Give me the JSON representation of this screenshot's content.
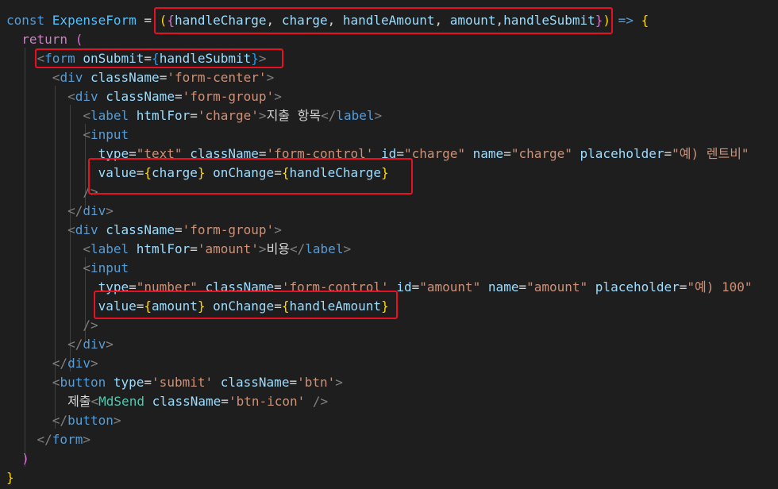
{
  "editor": {
    "lines": [
      [
        [
          "const ",
          "kw"
        ],
        [
          "ExpenseForm",
          "const"
        ],
        [
          " = ",
          "op"
        ],
        [
          "(",
          "brace1"
        ],
        [
          "{",
          "brace2"
        ],
        [
          "handleCharge",
          "var"
        ],
        [
          ", ",
          "plain"
        ],
        [
          "charge",
          "var"
        ],
        [
          ", ",
          "plain"
        ],
        [
          "handleAmount",
          "var"
        ],
        [
          ", ",
          "plain"
        ],
        [
          "amount",
          "var"
        ],
        [
          ",",
          "plain"
        ],
        [
          "handleSubmit",
          "var"
        ],
        [
          "}",
          "brace2"
        ],
        [
          ")",
          "brace1"
        ],
        [
          " => ",
          "kw"
        ],
        [
          "{",
          "brace1"
        ]
      ],
      [
        [
          "  ",
          "plain"
        ],
        [
          "return",
          "ctrl"
        ],
        [
          " ",
          "plain"
        ],
        [
          "(",
          "brace2"
        ]
      ],
      [
        [
          "    ",
          "plain"
        ],
        [
          "<",
          "punct"
        ],
        [
          "form",
          "tag"
        ],
        [
          " ",
          "plain"
        ],
        [
          "onSubmit",
          "attr"
        ],
        [
          "=",
          "op"
        ],
        [
          "{",
          "brace3"
        ],
        [
          "handleSubmit",
          "var"
        ],
        [
          "}",
          "brace3"
        ],
        [
          ">",
          "punct"
        ]
      ],
      [
        [
          "      ",
          "plain"
        ],
        [
          "<",
          "punct"
        ],
        [
          "div",
          "tag"
        ],
        [
          " ",
          "plain"
        ],
        [
          "className",
          "attr"
        ],
        [
          "=",
          "op"
        ],
        [
          "'form-center'",
          "str"
        ],
        [
          ">",
          "punct"
        ]
      ],
      [
        [
          "        ",
          "plain"
        ],
        [
          "<",
          "punct"
        ],
        [
          "div",
          "tag"
        ],
        [
          " ",
          "plain"
        ],
        [
          "className",
          "attr"
        ],
        [
          "=",
          "op"
        ],
        [
          "'form-group'",
          "str"
        ],
        [
          ">",
          "punct"
        ]
      ],
      [
        [
          "          ",
          "plain"
        ],
        [
          "<",
          "punct"
        ],
        [
          "label",
          "tag"
        ],
        [
          " ",
          "plain"
        ],
        [
          "htmlFor",
          "attr"
        ],
        [
          "=",
          "op"
        ],
        [
          "'charge'",
          "str"
        ],
        [
          ">",
          "punct"
        ],
        [
          "지출 항목",
          "plain"
        ],
        [
          "</",
          "punct"
        ],
        [
          "label",
          "tag"
        ],
        [
          ">",
          "punct"
        ]
      ],
      [
        [
          "          ",
          "plain"
        ],
        [
          "<",
          "punct"
        ],
        [
          "input",
          "tag"
        ]
      ],
      [
        [
          "            ",
          "plain"
        ],
        [
          "type",
          "attr"
        ],
        [
          "=",
          "op"
        ],
        [
          "\"text\"",
          "str"
        ],
        [
          " ",
          "plain"
        ],
        [
          "className",
          "attr"
        ],
        [
          "=",
          "op"
        ],
        [
          "'form-control'",
          "str"
        ],
        [
          " ",
          "plain"
        ],
        [
          "id",
          "attr"
        ],
        [
          "=",
          "op"
        ],
        [
          "\"charge\"",
          "str"
        ],
        [
          " ",
          "plain"
        ],
        [
          "name",
          "attr"
        ],
        [
          "=",
          "op"
        ],
        [
          "\"charge\"",
          "str"
        ],
        [
          " ",
          "plain"
        ],
        [
          "placeholder",
          "attr"
        ],
        [
          "=",
          "op"
        ],
        [
          "\"예) 렌트비\"",
          "str"
        ]
      ],
      [
        [
          "            ",
          "plain"
        ],
        [
          "value",
          "attr"
        ],
        [
          "=",
          "op"
        ],
        [
          "{",
          "brace1"
        ],
        [
          "charge",
          "var"
        ],
        [
          "}",
          "brace1"
        ],
        [
          " ",
          "plain"
        ],
        [
          "onChange",
          "attr"
        ],
        [
          "=",
          "op"
        ],
        [
          "{",
          "brace1"
        ],
        [
          "handleCharge",
          "var"
        ],
        [
          "}",
          "brace1"
        ]
      ],
      [
        [
          "          ",
          "plain"
        ],
        [
          "/>",
          "punct"
        ]
      ],
      [
        [
          "        ",
          "plain"
        ],
        [
          "</",
          "punct"
        ],
        [
          "div",
          "tag"
        ],
        [
          ">",
          "punct"
        ]
      ],
      [
        [
          "        ",
          "plain"
        ],
        [
          "<",
          "punct"
        ],
        [
          "div",
          "tag"
        ],
        [
          " ",
          "plain"
        ],
        [
          "className",
          "attr"
        ],
        [
          "=",
          "op"
        ],
        [
          "'form-group'",
          "str"
        ],
        [
          ">",
          "punct"
        ]
      ],
      [
        [
          "          ",
          "plain"
        ],
        [
          "<",
          "punct"
        ],
        [
          "label",
          "tag"
        ],
        [
          " ",
          "plain"
        ],
        [
          "htmlFor",
          "attr"
        ],
        [
          "=",
          "op"
        ],
        [
          "'amount'",
          "str"
        ],
        [
          ">",
          "punct"
        ],
        [
          "비용",
          "plain"
        ],
        [
          "</",
          "punct"
        ],
        [
          "label",
          "tag"
        ],
        [
          ">",
          "punct"
        ]
      ],
      [
        [
          "          ",
          "plain"
        ],
        [
          "<",
          "punct"
        ],
        [
          "input",
          "tag"
        ]
      ],
      [
        [
          "            ",
          "plain"
        ],
        [
          "type",
          "attr"
        ],
        [
          "=",
          "op"
        ],
        [
          "\"number\"",
          "str"
        ],
        [
          " ",
          "plain"
        ],
        [
          "className",
          "attr"
        ],
        [
          "=",
          "op"
        ],
        [
          "'form-control'",
          "str"
        ],
        [
          " ",
          "plain"
        ],
        [
          "id",
          "attr"
        ],
        [
          "=",
          "op"
        ],
        [
          "\"amount\"",
          "str"
        ],
        [
          " ",
          "plain"
        ],
        [
          "name",
          "attr"
        ],
        [
          "=",
          "op"
        ],
        [
          "\"amount\"",
          "str"
        ],
        [
          " ",
          "plain"
        ],
        [
          "placeholder",
          "attr"
        ],
        [
          "=",
          "op"
        ],
        [
          "\"예) 100\"",
          "str"
        ]
      ],
      [
        [
          "            ",
          "plain"
        ],
        [
          "value",
          "attr"
        ],
        [
          "=",
          "op"
        ],
        [
          "{",
          "brace1"
        ],
        [
          "amount",
          "var"
        ],
        [
          "}",
          "brace1"
        ],
        [
          " ",
          "plain"
        ],
        [
          "onChange",
          "attr"
        ],
        [
          "=",
          "op"
        ],
        [
          "{",
          "brace1"
        ],
        [
          "handleAmount",
          "var"
        ],
        [
          "}",
          "brace1"
        ]
      ],
      [
        [
          "          ",
          "plain"
        ],
        [
          "/>",
          "punct"
        ]
      ],
      [
        [
          "        ",
          "plain"
        ],
        [
          "</",
          "punct"
        ],
        [
          "div",
          "tag"
        ],
        [
          ">",
          "punct"
        ]
      ],
      [
        [
          "      ",
          "plain"
        ],
        [
          "</",
          "punct"
        ],
        [
          "div",
          "tag"
        ],
        [
          ">",
          "punct"
        ]
      ],
      [
        [
          "      ",
          "plain"
        ],
        [
          "<",
          "punct"
        ],
        [
          "button",
          "tag"
        ],
        [
          " ",
          "plain"
        ],
        [
          "type",
          "attr"
        ],
        [
          "=",
          "op"
        ],
        [
          "'submit'",
          "str"
        ],
        [
          " ",
          "plain"
        ],
        [
          "className",
          "attr"
        ],
        [
          "=",
          "op"
        ],
        [
          "'btn'",
          "str"
        ],
        [
          ">",
          "punct"
        ]
      ],
      [
        [
          "        ",
          "plain"
        ],
        [
          "제출",
          "plain"
        ],
        [
          "<",
          "punct"
        ],
        [
          "MdSend",
          "comp"
        ],
        [
          " ",
          "plain"
        ],
        [
          "className",
          "attr"
        ],
        [
          "=",
          "op"
        ],
        [
          "'btn-icon'",
          "str"
        ],
        [
          " ",
          "plain"
        ],
        [
          "/>",
          "punct"
        ]
      ],
      [
        [
          "      ",
          "plain"
        ],
        [
          "</",
          "punct"
        ],
        [
          "button",
          "tag"
        ],
        [
          ">",
          "punct"
        ]
      ],
      [
        [
          "    ",
          "plain"
        ],
        [
          "</",
          "punct"
        ],
        [
          "form",
          "tag"
        ],
        [
          ">",
          "punct"
        ]
      ],
      [
        [
          "  ",
          "plain"
        ],
        [
          ")",
          "brace2"
        ]
      ],
      [
        [
          "}",
          "brace1"
        ]
      ]
    ]
  },
  "highlight_color": "#e81123"
}
